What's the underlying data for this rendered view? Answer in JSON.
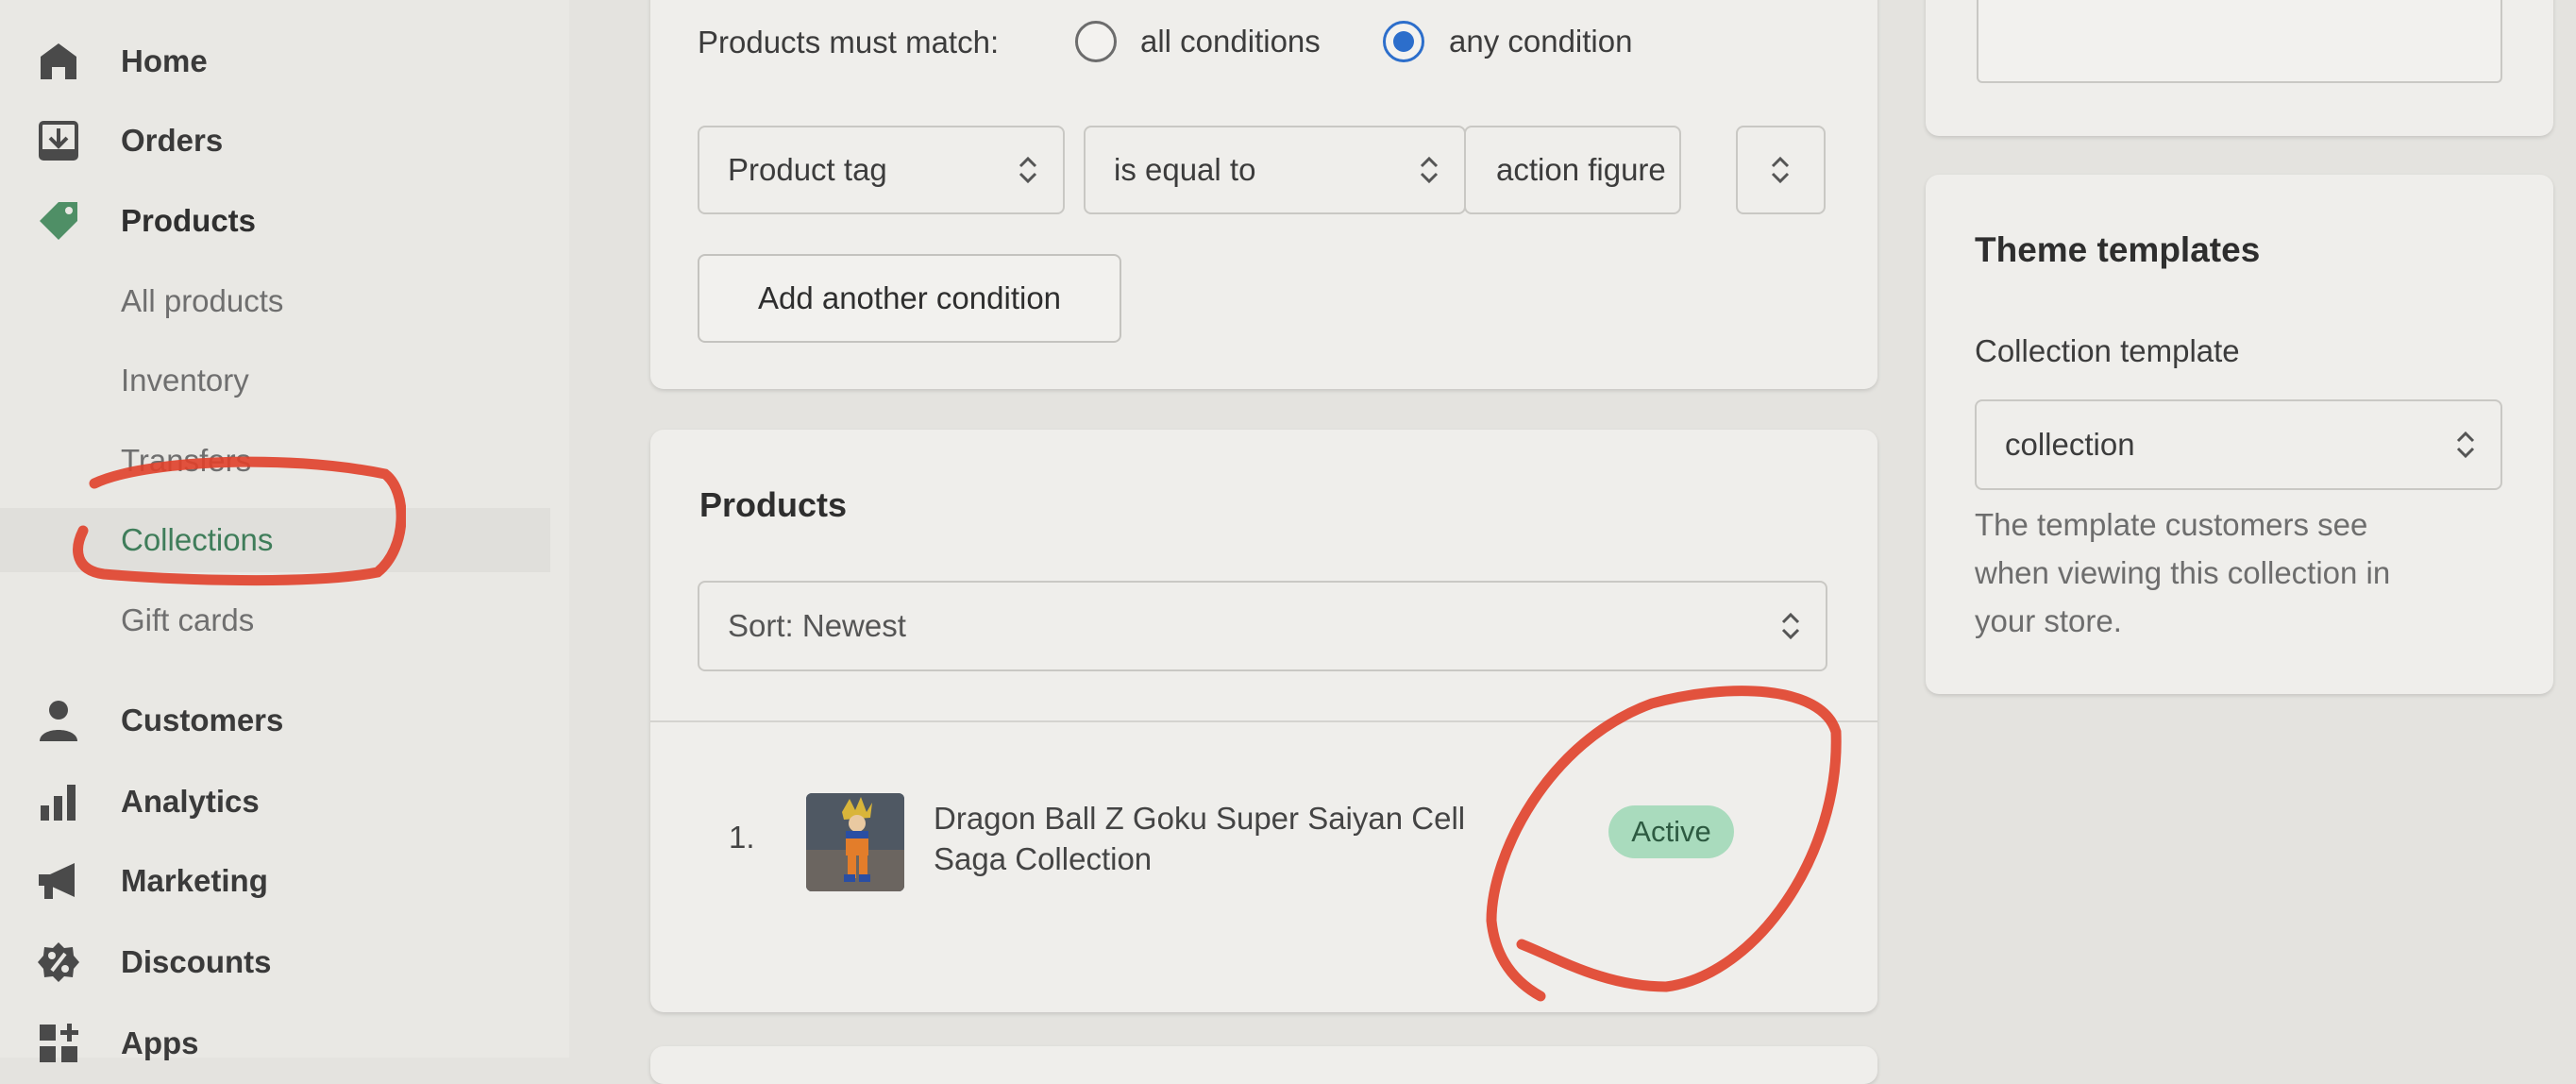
{
  "nav": {
    "home": "Home",
    "orders": "Orders",
    "products": "Products",
    "products_sub": {
      "all_products": "All products",
      "inventory": "Inventory",
      "transfers": "Transfers",
      "collections": "Collections",
      "gift_cards": "Gift cards"
    },
    "customers": "Customers",
    "analytics": "Analytics",
    "marketing": "Marketing",
    "discounts": "Discounts",
    "apps": "Apps"
  },
  "conditions": {
    "match_label": "Products must match:",
    "option_all": "all conditions",
    "option_any": "any condition",
    "selected": "any condition",
    "field": "Product tag",
    "operator": "is equal to",
    "value": "action figure",
    "add_button": "Add another condition"
  },
  "products_card": {
    "title": "Products",
    "sort": "Sort: Newest",
    "items": [
      {
        "index": "1.",
        "name_line1": "Dragon Ball Z Goku Super Saiyan Cell",
        "name_line2": "Saga Collection",
        "status": "Active"
      }
    ]
  },
  "theme": {
    "title": "Theme templates",
    "template_label": "Collection template",
    "template_value": "collection",
    "help_line1": "The template customers see",
    "help_line2": "when viewing this collection in",
    "help_line3": "your store."
  },
  "colors": {
    "accent_blue": "#2c6ecb",
    "active_green": "#3f7d5a",
    "badge_bg": "#a9dbbd",
    "annotation_red": "#e0402a"
  }
}
